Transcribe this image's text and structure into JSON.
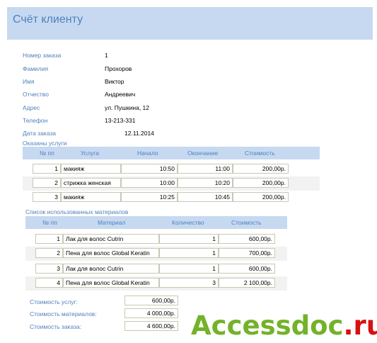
{
  "header": {
    "title": "Счёт клиенту"
  },
  "client": {
    "order_number_label": "Номер заказа",
    "order_number": "1",
    "surname_label": "Фамилия",
    "surname": "Прохоров",
    "name_label": "Имя",
    "name": "Виктор",
    "patronymic_label": "Отчество",
    "patronymic": "Андреевич",
    "address_label": "Адрес",
    "address": "ул. Пушкина, 12",
    "phone_label": "Телефон",
    "phone": "13-213-331",
    "date_label": "Дата заказа",
    "date": "12.11.2014"
  },
  "services": {
    "section_title": "Оказаны услуги",
    "headers": {
      "num": "№ пп",
      "service": "Услуга",
      "start": "Начало",
      "end": "Окончание",
      "cost": "Стоимость"
    },
    "rows": [
      {
        "num": "1",
        "service": "макияж",
        "start": "10:50",
        "end": "11:00",
        "cost": "200,00р."
      },
      {
        "num": "2",
        "service": "стрижка женская",
        "start": "10:00",
        "end": "10:20",
        "cost": "200,00р."
      },
      {
        "num": "3",
        "service": "макияж",
        "start": "10:25",
        "end": "10:45",
        "cost": "200,00р."
      }
    ]
  },
  "materials": {
    "section_title": "Список использованных материалов",
    "headers": {
      "num": "№ пп",
      "material": "Материал",
      "qty": "Количество",
      "cost": "Стоимость"
    },
    "rows": [
      {
        "num": "1",
        "material": "Лак для волос Cutrin",
        "qty": "1",
        "cost": "600,00р."
      },
      {
        "num": "2",
        "material": "Пена для волос Global Keratin",
        "qty": "1",
        "cost": "700,00р."
      },
      {
        "num": "3",
        "material": "Лак для волос Cutrin",
        "qty": "1",
        "cost": "600,00р."
      },
      {
        "num": "4",
        "material": "Пена для волос Global Keratin",
        "qty": "3",
        "cost": "2 100,00р."
      }
    ]
  },
  "totals": {
    "services_label": "Стоимость услуг:",
    "services_value": "600,00р.",
    "materials_label": "Стоимость материалов:",
    "materials_value": "4 000,00р.",
    "order_label": "Стоимость заказа:",
    "order_value": "4 600,00р."
  },
  "watermark": {
    "part1": "Accessdoc",
    "part2": ".ru"
  }
}
